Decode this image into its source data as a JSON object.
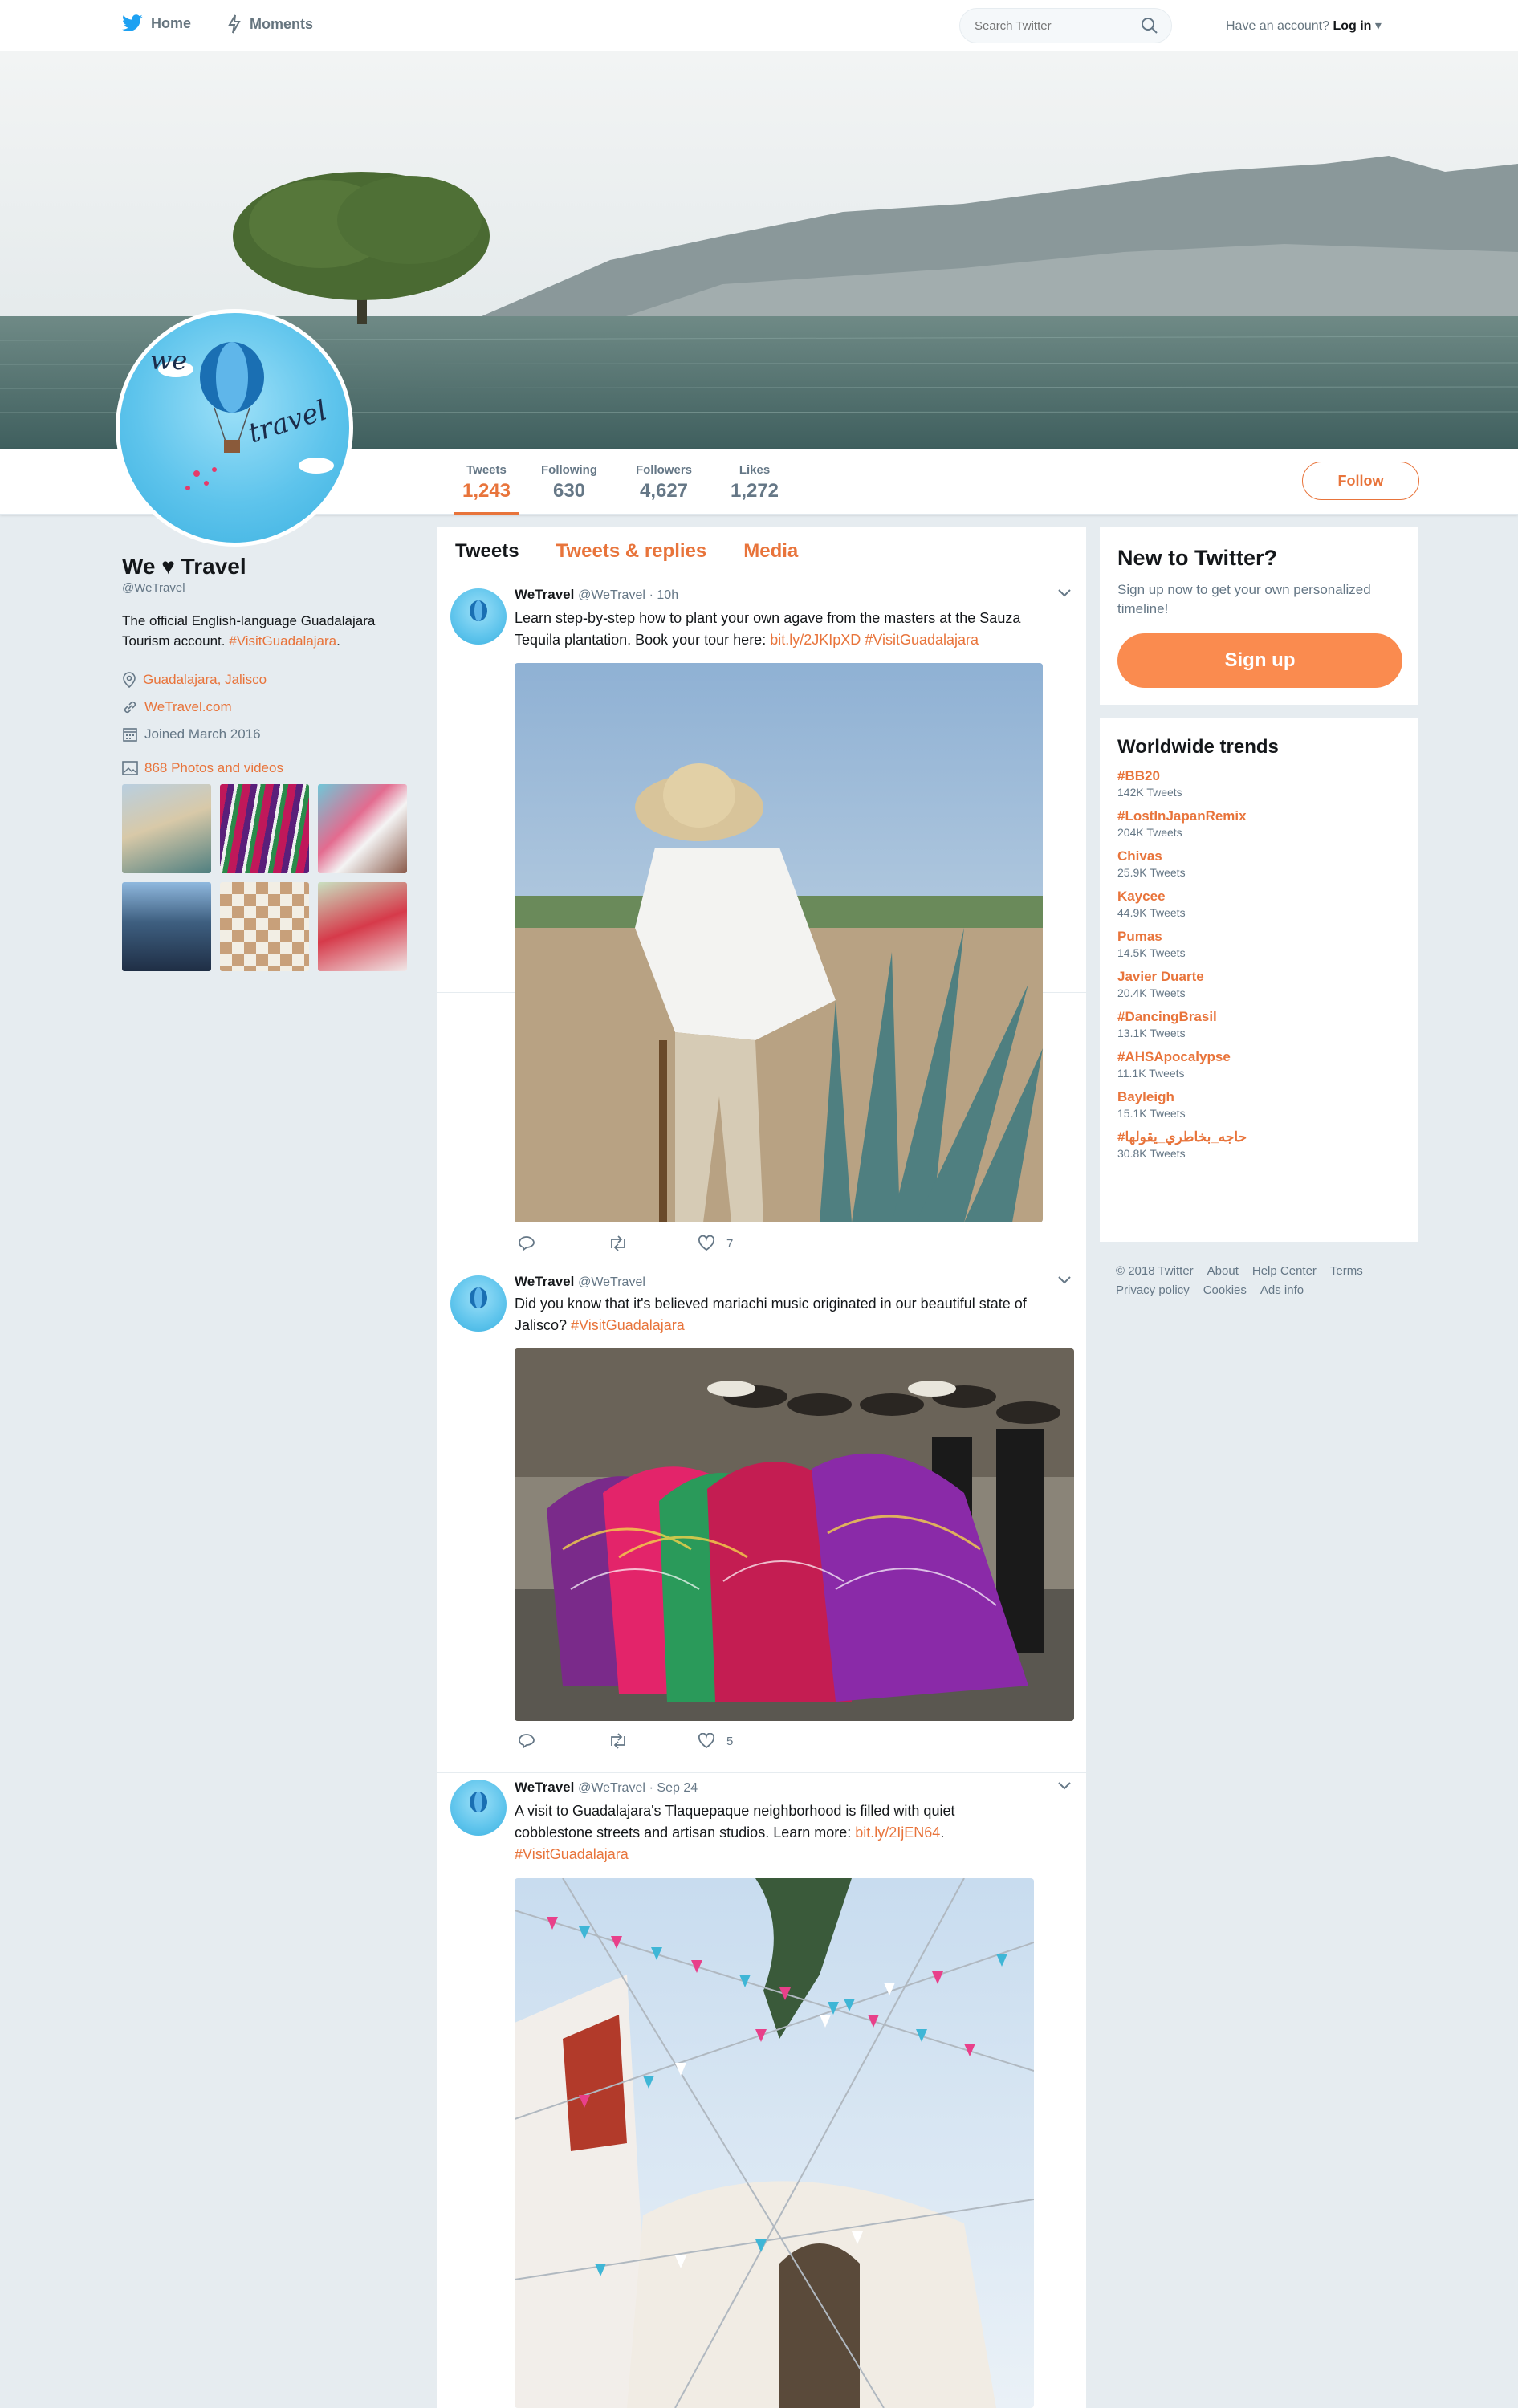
{
  "nav": {
    "home": "Home",
    "moments": "Moments",
    "search_placeholder": "Search Twitter",
    "have_account": "Have an account?",
    "login": "Log in"
  },
  "profile": {
    "name": "We ♥ Travel",
    "handle": "@WeTravel",
    "bio": "The official English-language Guadalajara Tourism account.",
    "bio_tag": "#VisitGuadalajara",
    "bio_end": ".",
    "location": "Guadalajara, Jalisco",
    "url": "WeTravel.com",
    "joined": "Joined March 2016",
    "photos": "868 Photos and videos",
    "avatar_line1": "we",
    "avatar_line2": "travel"
  },
  "stats": {
    "tweets_label": "Tweets",
    "tweets": "1,243",
    "following_label": "Following",
    "following": "630",
    "followers_label": "Followers",
    "followers": "4,627",
    "likes_label": "Likes",
    "likes": "1,272",
    "follow_button": "Follow"
  },
  "tabs": [
    "Tweets",
    "Tweets & replies",
    "Media"
  ],
  "tweets": [
    {
      "name": "WeTravel",
      "handle": "@WeTravel",
      "time": "· 10h",
      "line1": "Learn step-by-step how to plant your own agave from the masters at the Sauza",
      "line2a": "Tequila plantation. Book your tour here: ",
      "link": "bit.ly/2JKIpXD",
      "tag": "#VisitGuadalajara",
      "likes": "7"
    },
    {
      "name": "WeTravel",
      "handle": "@WeTravel",
      "time": "",
      "line1": "Did you know that it's believed mariachi music originated in our beautiful state of",
      "line2a": "Jalisco? ",
      "tag": "#VisitGuadalajara",
      "likes": "5"
    },
    {
      "name": "WeTravel",
      "handle": "@WeTravel",
      "time": "· Sep 24",
      "line1": "A visit to Guadalajara's Tlaquepaque neighborhood is filled with quiet",
      "line2a": "cobblestone streets and artisan studios. Learn more: ",
      "link": "bit.ly/2IjEN64",
      "line2b": ".",
      "tag": "#VisitGuadalajara"
    }
  ],
  "signup": {
    "title": "New to Twitter?",
    "sub": "Sign up now to get your own personalized timeline!",
    "button": "Sign up"
  },
  "trends": {
    "title": "Worldwide trends",
    "items": [
      {
        "name": "#BB20",
        "count": "142K Tweets"
      },
      {
        "name": "#LostInJapanRemix",
        "count": "204K Tweets"
      },
      {
        "name": "Chivas",
        "count": "25.9K Tweets"
      },
      {
        "name": "Kaycee",
        "count": "44.9K Tweets"
      },
      {
        "name": "Pumas",
        "count": "14.5K Tweets"
      },
      {
        "name": "Javier Duarte",
        "count": "20.4K Tweets"
      },
      {
        "name": "#DancingBrasil",
        "count": "13.1K Tweets"
      },
      {
        "name": "#AHSApocalypse",
        "count": "11.1K Tweets"
      },
      {
        "name": "Bayleigh",
        "count": "15.1K Tweets"
      },
      {
        "name": "#حاجه_بخاطري_يقولها",
        "count": "30.8K Tweets"
      }
    ]
  },
  "footer": {
    "copyright": "© 2018 Twitter",
    "about": "About",
    "help": "Help Center",
    "terms": "Terms",
    "privacy": "Privacy policy",
    "cookies": "Cookies",
    "ads": "Ads info"
  },
  "colors": {
    "accent": "#e8743b",
    "signup": "#fa8b4f",
    "twitter_blue": "#1da1f2"
  }
}
